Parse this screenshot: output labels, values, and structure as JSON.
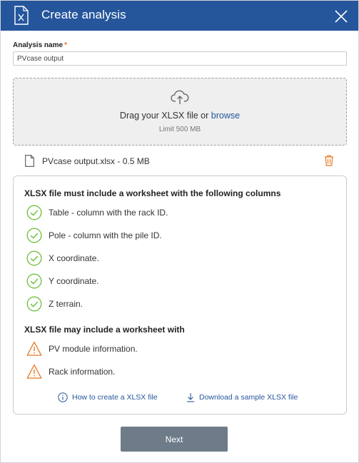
{
  "header": {
    "title": "Create analysis",
    "icon": "xlsx-file-icon",
    "color": "#25569c"
  },
  "form": {
    "name_label": "Analysis name",
    "required_mark": "*",
    "name_value": "PVcase output"
  },
  "dropzone": {
    "text_prefix": "Drag your XLSX file or ",
    "browse_label": "browse",
    "limit": "Limit 500 MB"
  },
  "file": {
    "name": "PVcase output.xlsx - 0.5 MB"
  },
  "requirements": {
    "must_title": "XLSX file must include a worksheet with the following columns",
    "must_items": [
      "Table - column with the rack ID.",
      "Pole - column with the pile ID.",
      "X coordinate.",
      "Y coordinate.",
      "Z terrain."
    ],
    "may_title": "XLSX file may include a worksheet with",
    "may_items": [
      "PV module information.",
      "Rack information."
    ],
    "how_to_link": "How to create a XLSX file",
    "download_link": "Download a sample XLSX file"
  },
  "footer": {
    "next_label": "Next"
  },
  "colors": {
    "ok": "#6cbf3a",
    "warn": "#e87722",
    "link": "#25569c",
    "button": "#6e7b89"
  }
}
